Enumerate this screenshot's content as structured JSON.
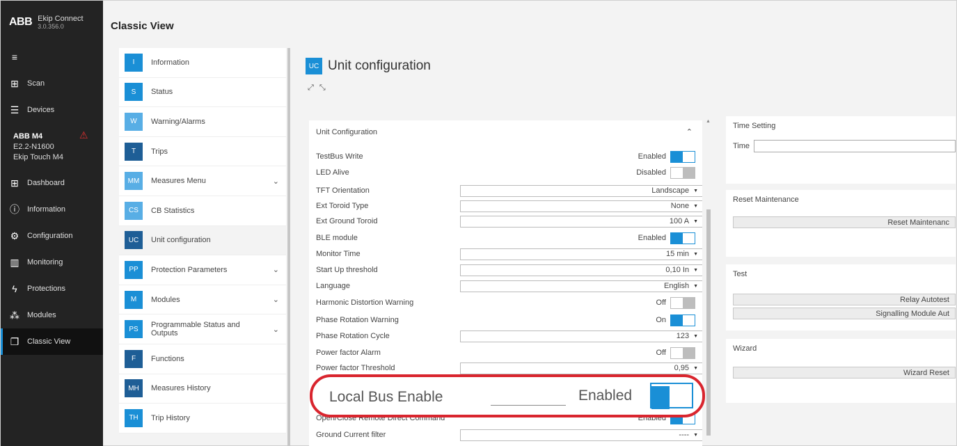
{
  "brand": {
    "logo": "ABB",
    "app_name": "Ekip Connect",
    "version": "3.0.356.0"
  },
  "sidebar": {
    "top_items": [
      {
        "label": "Scan",
        "icon": "scan-icon"
      },
      {
        "label": "Devices",
        "icon": "list-icon"
      }
    ],
    "device": {
      "name": "ABB M4",
      "model": "E2.2-N1600",
      "trip_unit": "Ekip Touch M4"
    },
    "items": [
      {
        "label": "Dashboard",
        "icon": "dashboard-icon"
      },
      {
        "label": "Information",
        "icon": "info-icon"
      },
      {
        "label": "Configuration",
        "icon": "gears-icon"
      },
      {
        "label": "Monitoring",
        "icon": "monitoring-icon"
      },
      {
        "label": "Protections",
        "icon": "bolt-icon"
      },
      {
        "label": "Modules",
        "icon": "modules-icon"
      },
      {
        "label": "Classic View",
        "icon": "window-icon"
      }
    ]
  },
  "header": {
    "title": "Classic View"
  },
  "modules": [
    {
      "code": "I",
      "label": "Information"
    },
    {
      "code": "S",
      "label": "Status"
    },
    {
      "code": "W",
      "label": "Warning/Alarms"
    },
    {
      "code": "T",
      "label": "Trips"
    },
    {
      "code": "MM",
      "label": "Measures Menu"
    },
    {
      "code": "CS",
      "label": "CB Statistics"
    },
    {
      "code": "UC",
      "label": "Unit configuration"
    },
    {
      "code": "PP",
      "label": "Protection Parameters"
    },
    {
      "code": "M",
      "label": "Modules"
    },
    {
      "code": "PS",
      "label": "Programmable Status and Outputs"
    },
    {
      "code": "F",
      "label": "Functions"
    },
    {
      "code": "MH",
      "label": "Measures History"
    },
    {
      "code": "TH",
      "label": "Trip History"
    }
  ],
  "main": {
    "badge": "UC",
    "title": "Unit configuration",
    "panel_title": "Unit Configuration",
    "rows": [
      {
        "label": "TestBus Write",
        "value": "Enabled"
      },
      {
        "label": "LED Alive",
        "value": "Disabled"
      },
      {
        "label": "TFT Orientation",
        "value": "Landscape"
      },
      {
        "label": "Ext Toroid Type",
        "value": "None"
      },
      {
        "label": "Ext Ground Toroid",
        "value": "100 A"
      },
      {
        "label": "BLE module",
        "value": "Enabled"
      },
      {
        "label": "Monitor Time",
        "value": "15 min"
      },
      {
        "label": "Start Up threshold",
        "value": "0,10 In"
      },
      {
        "label": "Language",
        "value": "English"
      },
      {
        "label": "Harmonic Distortion Warning",
        "value": "Off"
      },
      {
        "label": "Phase Rotation Warning",
        "value": "On"
      },
      {
        "label": "Phase Rotation Cycle",
        "value": "123"
      },
      {
        "label": "Power factor Alarm",
        "value": "Off"
      },
      {
        "label": "Power factor Threshold",
        "value": "0,95"
      },
      {
        "label": "Open/Close Remote Direct Command",
        "value": "Enabled"
      },
      {
        "label": "Ground Current filter",
        "value": "----"
      }
    ],
    "callout": {
      "label": "Local Bus Enable",
      "value": "Enabled"
    }
  },
  "right": {
    "time_setting": {
      "title": "Time Setting",
      "time_label": "Time"
    },
    "reset_maintenance": {
      "title": "Reset Maintenance",
      "button": "Reset Maintenanc"
    },
    "test": {
      "title": "Test",
      "relay_button": "Relay Autotest",
      "signalling_button": "Signalling Module Aut"
    },
    "wizard": {
      "title": "Wizard",
      "button": "Wizard Reset"
    }
  },
  "colors": {
    "accent": "#1a8fd6",
    "sidebar_bg": "#232323",
    "highlight": "#d9252e"
  }
}
